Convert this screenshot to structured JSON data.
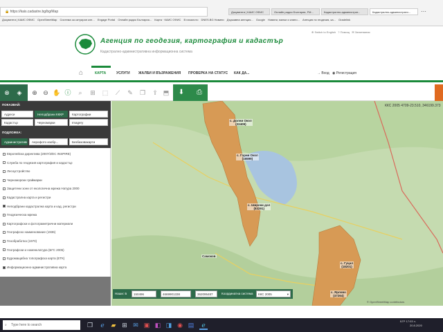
{
  "browser": {
    "address": "https://kais.cadastre.bg/bg/Map",
    "tabs": [
      {
        "label": "Документи | КАИС ОФИС"
      },
      {
        "label": "Онлайн радио България, FM..."
      },
      {
        "label": "Кадастрално-администрат..."
      },
      {
        "label": "Кадастрално-администрати..."
      }
    ],
    "bookmarks": [
      "Документи | КАИС ОФИС",
      "OpenStreetMap",
      "Система за ситуиран кле...",
      "Engage Portal",
      "Онлайн радио България...",
      "Карта · КАИС ОФИС",
      "В началото",
      "DNES.BG Новини",
      "Държавна агенция...",
      "Google",
      "Новини, милки и клипо...",
      "Агенция по геодезия, ка...",
      "Gradelink"
    ]
  },
  "header": {
    "title": "Агенция по геодезия, картография и кадастър",
    "subtitle": "Кадастрално-административна информационна система",
    "util_lang": "Switch to English",
    "util_help": "Помощ",
    "util_contact": "Запитвания"
  },
  "nav": {
    "items": [
      "КАРТА",
      "УСЛУГИ",
      "ЖАЛБИ И ВЪЗРАЖЕНИЯ",
      "ПРОВЕРКА НА СТАТУС",
      "КАК ДА..."
    ],
    "login": "Вход",
    "register": "Регистрация"
  },
  "sidebar": {
    "legend_title": "ПОКАЗВАЙ:",
    "legend_buttons": [
      "Адреси",
      "Неподбрани КККР",
      "Картографии",
      "Кадастър",
      "Черномарки",
      "Imagery"
    ],
    "layers_title": "ПОДЛОЖКА:",
    "base_buttons": [
      "Административна...",
      "Аерофото изобр...",
      "Безбазовакарти"
    ],
    "layers": [
      {
        "label": "Европейска директива (2007/2/ЕС INSPIRE)",
        "checked": false
      },
      {
        "label": "Служба по геодезия картография и кадастър",
        "checked": false
      },
      {
        "label": "Лесоустройство",
        "checked": false
      },
      {
        "label": "Черноморски граймарки",
        "checked": false
      },
      {
        "label": "Защитени зони от екологична мрежа Натура 2000",
        "checked": false
      },
      {
        "label": "Кадастрална карта и регистри",
        "checked": false
      },
      {
        "label": "Неподбрани кадастрална карта и кад. регистри",
        "checked": true
      },
      {
        "label": "Геодезическа мрежа",
        "checked": false
      },
      {
        "label": "Картографски и фотограметрични материали",
        "checked": false
      },
      {
        "label": "Географско наименование (1936)",
        "checked": false
      },
      {
        "label": "Геообработка (1970)",
        "checked": false
      },
      {
        "label": "Географски и номенклатура (БГС 2005)",
        "checked": false
      },
      {
        "label": "Едромащабна топографска карта (ЕТК)",
        "checked": false
      },
      {
        "label": "Информационно-административна карта",
        "checked": true
      }
    ]
  },
  "map": {
    "coord_readout": "ККС 2005 4709-23.510, 346199.373",
    "places": [
      {
        "name": "с. Долни Окол",
        "code": "(22409)"
      },
      {
        "name": "с. Горни Окол",
        "code": "(16599)"
      },
      {
        "name": "с. Широки дол",
        "code": "(83291)"
      },
      {
        "name": "с. Гуцал",
        "code": "(18201)"
      },
      {
        "name": "с. Ярлово",
        "code": "(47264)"
      },
      {
        "name": "Самоков",
        "code": ""
      }
    ],
    "attribution": "© OpenStreetMap contributors"
  },
  "coord_bar": {
    "label_x": "Наши: Б",
    "x_value": "150496",
    "y_value": "4669901338",
    "z_value": "362095487",
    "system_label": "Координатна система",
    "system_value": "ККС 2005"
  },
  "taskbar": {
    "search_placeholder": "Type here to search",
    "lang": "БГР",
    "time": "17:03 ч.",
    "date": "20.8.2020"
  },
  "colors": {
    "brand_green": "#1a8a3a",
    "dark_green": "#2d6b4a",
    "parcel_fill": "#d79a55",
    "map_bg": "#c5dbb0",
    "water": "#a8c4e0"
  }
}
